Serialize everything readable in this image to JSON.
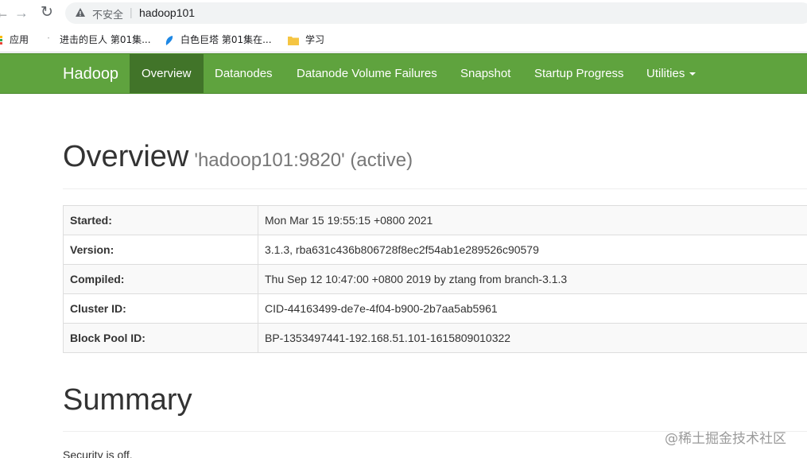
{
  "browser": {
    "security_label": "不安全",
    "url": "hadoop101",
    "bookmarks": [
      {
        "label": "应用",
        "icon": "apps-grid-icon"
      },
      {
        "label": "进击的巨人 第01集...",
        "icon": "page-icon"
      },
      {
        "label": "白色巨塔 第01集在...",
        "icon": "feather-icon"
      },
      {
        "label": "学习",
        "icon": "folder-icon"
      }
    ]
  },
  "navbar": {
    "brand": "Hadoop",
    "items": [
      {
        "label": "Overview",
        "active": true
      },
      {
        "label": "Datanodes"
      },
      {
        "label": "Datanode Volume Failures"
      },
      {
        "label": "Snapshot"
      },
      {
        "label": "Startup Progress"
      },
      {
        "label": "Utilities"
      }
    ]
  },
  "overview": {
    "title": "Overview",
    "subtitle": "'hadoop101:9820' (active)",
    "rows": [
      {
        "key": "Started:",
        "value": "Mon Mar 15 19:55:15 +0800 2021"
      },
      {
        "key": "Version:",
        "value": "3.1.3, rba631c436b806728f8ec2f54ab1e289526c90579"
      },
      {
        "key": "Compiled:",
        "value": "Thu Sep 12 10:47:00 +0800 2019 by ztang from branch-3.1.3"
      },
      {
        "key": "Cluster ID:",
        "value": "CID-44163499-de7e-4f04-b900-2b7aa5ab5961"
      },
      {
        "key": "Block Pool ID:",
        "value": "BP-1353497441-192.168.51.101-1615809010322"
      }
    ]
  },
  "summary": {
    "title": "Summary",
    "security": "Security is off."
  },
  "watermark": "@稀土掘金技术社区"
}
